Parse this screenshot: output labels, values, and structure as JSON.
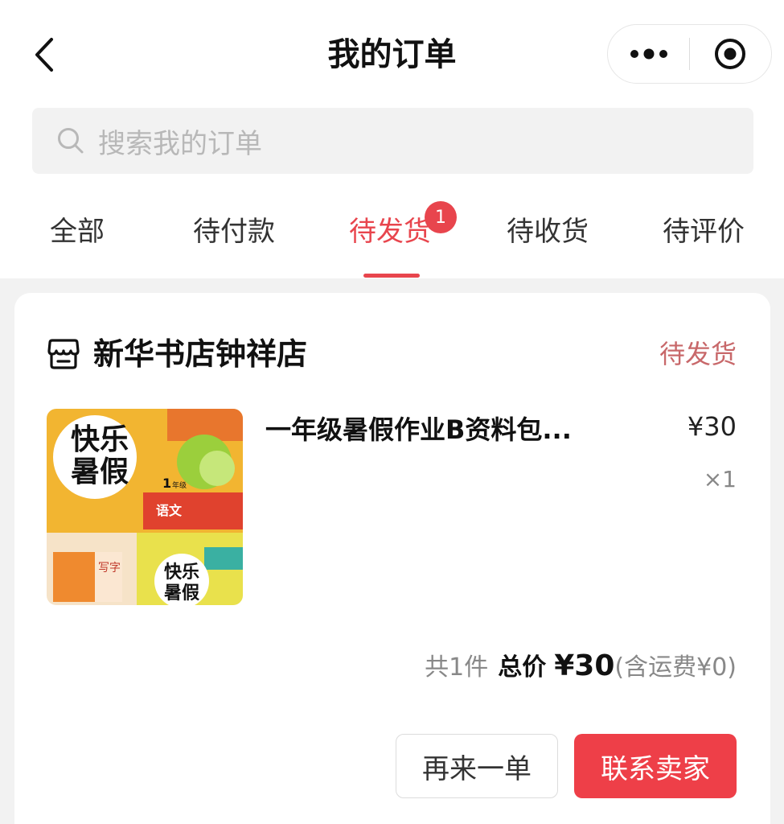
{
  "header": {
    "title": "我的订单"
  },
  "search": {
    "placeholder": "搜索我的订单"
  },
  "tabs": [
    {
      "label": "全部"
    },
    {
      "label": "待付款"
    },
    {
      "label": "待发货",
      "active": true,
      "badge": "1"
    },
    {
      "label": "待收货"
    },
    {
      "label": "待评价"
    }
  ],
  "order": {
    "store_name": "新华书店钟祥店",
    "status": "待发货",
    "product": {
      "name": "一年级暑假作业B资料包...",
      "price": "¥30",
      "qty": "×1",
      "cover_text": {
        "title_line1": "快乐",
        "title_line2": "暑假",
        "grade": "1",
        "grade_unit": "年级",
        "subject": "语文",
        "writing": "写字"
      }
    },
    "summary": {
      "count": "共1件",
      "total_label": "总价",
      "total_amount": "¥30",
      "shipping": "(含运费¥0)"
    },
    "buttons": {
      "reorder": "再来一单",
      "contact": "联系卖家"
    }
  },
  "colors": {
    "accent": "#e8454d",
    "button_red": "#ee3f48",
    "status_text": "#c8686a"
  }
}
